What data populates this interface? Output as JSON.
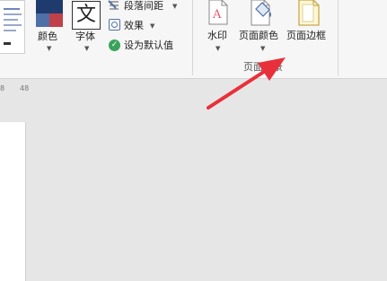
{
  "ribbon": {
    "document_formatting": {
      "colors_label": "颜色",
      "fonts_label": "字体",
      "fonts_icon_glyph": "文",
      "paragraph_spacing_label": "段落间距",
      "effects_label": "效果",
      "set_default_label": "设为默认值"
    },
    "page_background": {
      "watermark_label": "水印",
      "page_color_label": "页面颜色",
      "page_borders_label": "页面边框",
      "group_label": "页面背景"
    }
  },
  "ruler": {
    "tick_left": "8",
    "tick_right": "48"
  },
  "annotation": {
    "arrow_color": "#e8303a"
  },
  "colors": {
    "accent_green": "#3aa35a",
    "accent_blue": "#4f6fa8",
    "accent_red": "#c0404a"
  }
}
